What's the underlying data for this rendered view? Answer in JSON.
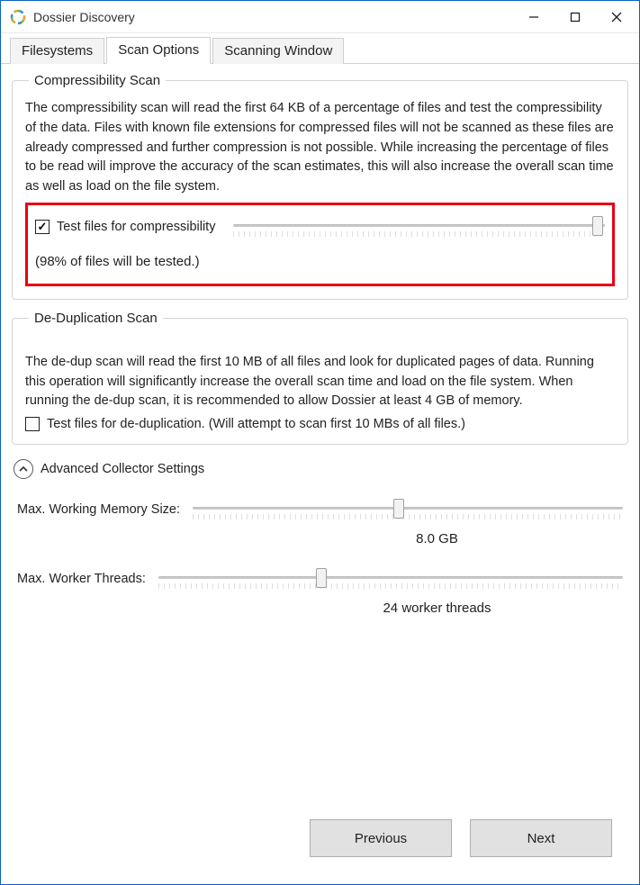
{
  "window": {
    "title": "Dossier Discovery"
  },
  "tabs": {
    "items": [
      {
        "label": "Filesystems"
      },
      {
        "label": "Scan Options"
      },
      {
        "label": "Scanning Window"
      }
    ],
    "active": 1
  },
  "compress": {
    "legend": "Compressibility Scan",
    "desc": "The compressibility scan will read the first 64 KB of a percentage of files and test the compressibility of the data. Files with known file extensions for compressed files will not be scanned as these files are already compressed and further compression is not possible. While increasing the percentage of files to be read will improve the accuracy of the scan estimates, this will also increase the overall scan time as well as load on the file system.",
    "check_label": "Test files for compressibility",
    "checked": true,
    "slider_percent": 98,
    "subtext": "(98% of files will be tested.)"
  },
  "dedup": {
    "legend": "De-Duplication Scan",
    "desc": "The de-dup scan will read the first 10 MB of all files and look for duplicated pages of data. Running this operation will significantly increase the overall scan time and load on the file system. When running the de-dup scan, it is recommended to allow Dossier at least 4 GB of memory.",
    "check_label": "Test files for de-duplication.  (Will attempt to scan first 10 MBs of all files.)",
    "checked": false
  },
  "advanced": {
    "label": "Advanced Collector Settings",
    "memory": {
      "label": "Max. Working Memory Size:",
      "value": "8.0 GB",
      "slider_percent": 48
    },
    "threads": {
      "label": "Max. Worker Threads:",
      "value": "24 worker threads",
      "slider_percent": 35
    }
  },
  "buttons": {
    "previous": "Previous",
    "next": "Next"
  }
}
